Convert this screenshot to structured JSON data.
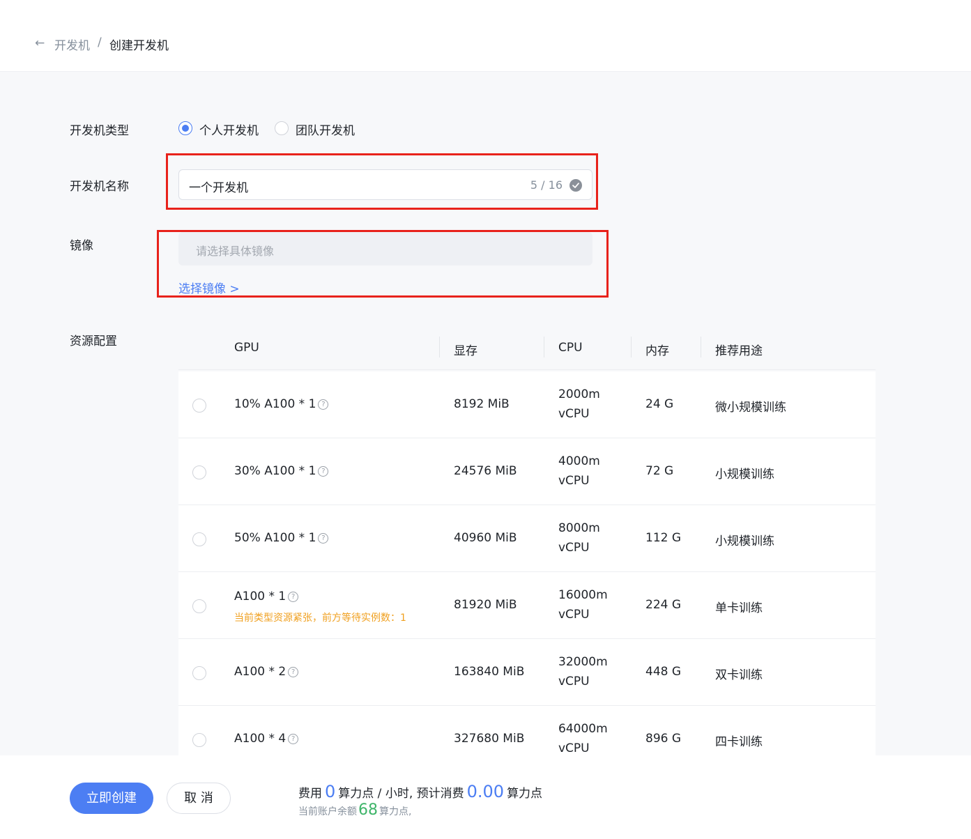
{
  "breadcrumb": {
    "back": "←",
    "parent": "开发机",
    "separator": "/",
    "current": "创建开发机"
  },
  "form": {
    "type_label": "开发机类型",
    "type_options": [
      "个人开发机",
      "团队开发机"
    ],
    "name_label": "开发机名称",
    "name_value": "一个开发机",
    "name_count": "5 / 16",
    "image_label": "镜像",
    "image_placeholder": "请选择具体镜像",
    "select_image_link": "选择镜像 >",
    "resource_label": "资源配置"
  },
  "table": {
    "headers": [
      "GPU",
      "显存",
      "CPU",
      "内存",
      "推荐用途"
    ],
    "rows": [
      {
        "gpu": "10% A100 * 1",
        "vram": "8192 MiB",
        "cpu1": "2000m",
        "cpu2": "vCPU",
        "mem": "24 G",
        "use": "微小规模训练"
      },
      {
        "gpu": "30% A100 * 1",
        "vram": "24576 MiB",
        "cpu1": "4000m",
        "cpu2": "vCPU",
        "mem": "72 G",
        "use": "小规模训练"
      },
      {
        "gpu": "50% A100 * 1",
        "vram": "40960 MiB",
        "cpu1": "8000m",
        "cpu2": "vCPU",
        "mem": "112 G",
        "use": "小规模训练"
      },
      {
        "gpu": "A100 * 1",
        "vram": "81920 MiB",
        "cpu1": "16000m",
        "cpu2": "vCPU",
        "mem": "224 G",
        "use": "单卡训练",
        "warning": "当前类型资源紧张，前方等待实例数：1"
      },
      {
        "gpu": "A100 * 2",
        "vram": "163840 MiB",
        "cpu1": "32000m",
        "cpu2": "vCPU",
        "mem": "448 G",
        "use": "双卡训练"
      },
      {
        "gpu": "A100 * 4",
        "vram": "327680 MiB",
        "cpu1": "64000m",
        "cpu2": "vCPU",
        "mem": "896 G",
        "use": "四卡训练"
      }
    ]
  },
  "footer": {
    "create_label": "立即创建",
    "cancel_label": "取 消",
    "cost_prefix": "费用",
    "cost_value": "0",
    "cost_mid": "算力点 / 小时, 预计消费",
    "estimate_value": "0.00",
    "cost_suffix": "算力点",
    "balance_prefix": "当前账户余额",
    "balance_value": "68",
    "balance_suffix": "算力点,"
  },
  "colors": {
    "accent": "#4c7ef3",
    "warning": "#f0a020",
    "success": "#3fb56a",
    "highlight_box": "#e8221b"
  },
  "icons": {
    "back": "arrow-left-icon",
    "check": "check-circle-icon",
    "help": "question-circle-icon"
  }
}
